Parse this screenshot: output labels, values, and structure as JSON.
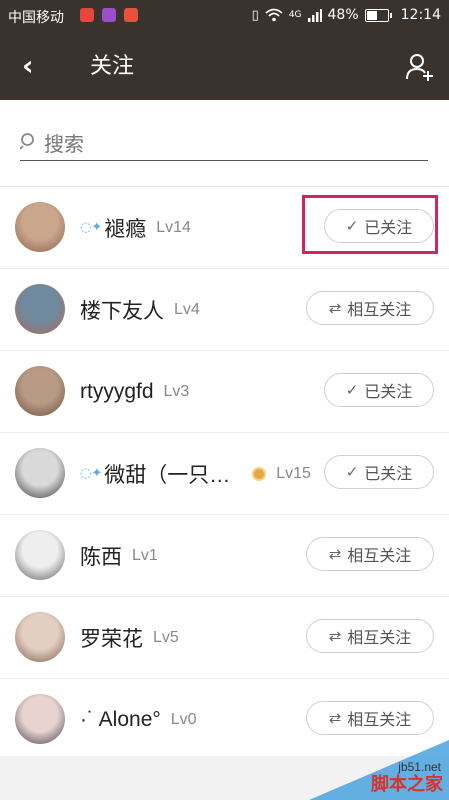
{
  "status_bar": {
    "carrier": "中国移动",
    "network": "4G",
    "battery": "48%",
    "battery_level": 0.48,
    "time": "12:14"
  },
  "header": {
    "back_glyph": "‹",
    "title": "关注",
    "add_user_icon": "add-user-icon"
  },
  "search": {
    "placeholder": "搜索"
  },
  "users": [
    {
      "deco": "◌✦",
      "name": "褪瘾",
      "level": "Lv14",
      "badge": false,
      "button": "已关注",
      "status": "followed",
      "avatar": [
        "#c9a68c",
        "#8b5e45"
      ]
    },
    {
      "deco": "",
      "name": "楼下友人",
      "level": "Lv4",
      "badge": false,
      "button": "相互关注",
      "status": "mutual",
      "avatar": [
        "#6f8a9e",
        "#b06a5a"
      ]
    },
    {
      "deco": "",
      "name": "rtyyygfd",
      "level": "Lv3",
      "badge": false,
      "button": "已关注",
      "status": "followed",
      "avatar": [
        "#b89a85",
        "#6b4e3d"
      ]
    },
    {
      "deco": "◌✦",
      "name": "微甜（一只…",
      "level": "Lv15",
      "badge": true,
      "button": "已关注",
      "status": "followed",
      "avatar": [
        "#d9d9d9",
        "#333333"
      ]
    },
    {
      "deco": "",
      "name": "陈西",
      "level": "Lv1",
      "badge": false,
      "button": "相互关注",
      "status": "mutual",
      "avatar": [
        "#eeeeee",
        "#555555"
      ]
    },
    {
      "deco": "",
      "name": "罗荣花",
      "level": "Lv5",
      "badge": false,
      "button": "相互关注",
      "status": "mutual",
      "avatar": [
        "#e3cfc2",
        "#7b5a48"
      ]
    },
    {
      "deco": "",
      "name": "·˙  Alone°",
      "level": "Lv0",
      "badge": false,
      "button": "相互关注",
      "status": "mutual",
      "avatar": [
        "#e9d3d0",
        "#3d3d45"
      ]
    }
  ],
  "glyphs": {
    "followed": "✓",
    "mutual": "⇄"
  },
  "colors": {
    "appbar": "#3a322d",
    "highlight": "#d5255f"
  },
  "watermark": {
    "site": "jb51.net",
    "text": "脚本之家"
  }
}
